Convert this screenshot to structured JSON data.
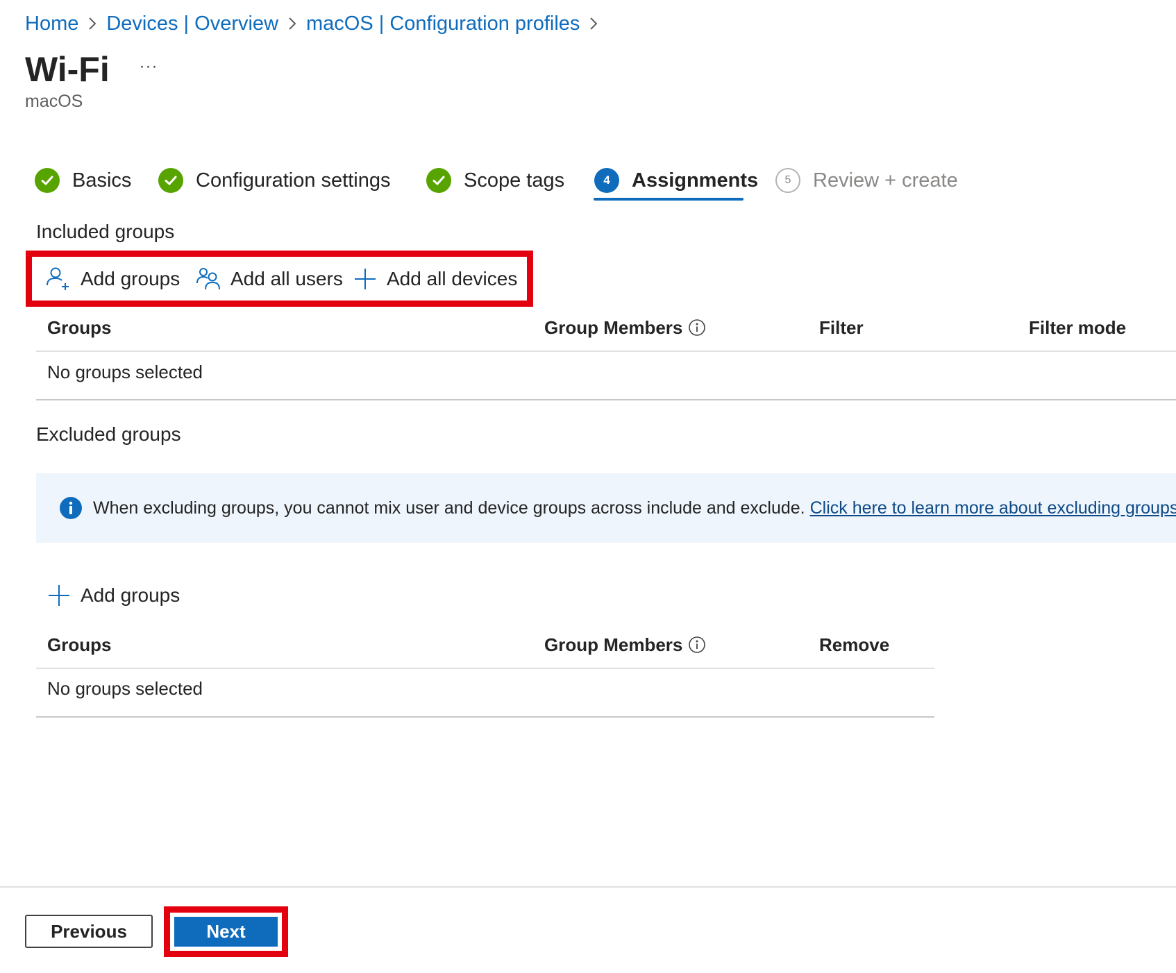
{
  "breadcrumb": [
    {
      "label": "Home"
    },
    {
      "label": "Devices | Overview"
    },
    {
      "label": "macOS | Configuration profiles"
    }
  ],
  "page": {
    "title": "Wi-Fi",
    "more_label": "···",
    "subtitle": "macOS"
  },
  "wizard": {
    "steps": [
      {
        "label": "Basics",
        "state": "complete"
      },
      {
        "label": "Configuration settings",
        "state": "complete"
      },
      {
        "label": "Scope tags",
        "state": "complete"
      },
      {
        "label": "Assignments",
        "number": "4",
        "state": "current"
      },
      {
        "label": "Review + create",
        "number": "5",
        "state": "upcoming"
      }
    ]
  },
  "included": {
    "title": "Included groups",
    "commands": {
      "add_groups": "Add groups",
      "add_all_users": "Add all users",
      "add_all_devices": "Add all devices"
    },
    "columns": {
      "groups": "Groups",
      "group_members": "Group Members",
      "filter": "Filter",
      "filter_mode": "Filter mode"
    },
    "empty_text": "No groups selected"
  },
  "excluded": {
    "title": "Excluded groups",
    "notice": {
      "text": "When excluding groups, you cannot mix user and device groups across include and exclude.",
      "link": "Click here to learn more about excluding groups."
    },
    "add_groups": "Add groups",
    "columns": {
      "groups": "Groups",
      "group_members": "Group Members",
      "remove": "Remove"
    },
    "empty_text": "No groups selected"
  },
  "footer": {
    "previous": "Previous",
    "next": "Next"
  },
  "colors": {
    "accent": "#0f6cbd",
    "success": "#57a300",
    "highlight": "#e3000f",
    "notice_bg": "#eef5fd"
  }
}
